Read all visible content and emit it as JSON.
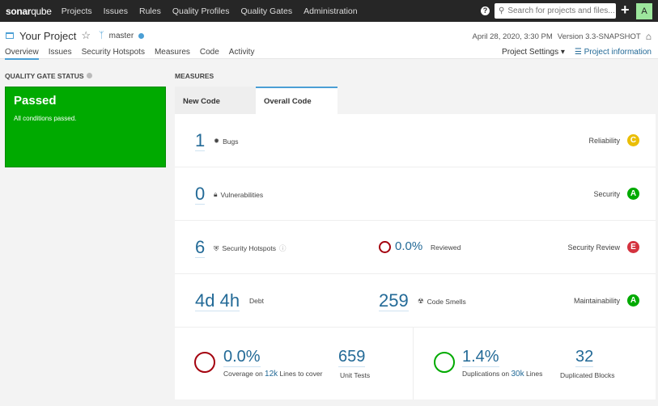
{
  "topbar": {
    "logo_bold": "sonar",
    "logo_rest": "qube",
    "nav": [
      "Projects",
      "Issues",
      "Rules",
      "Quality Profiles",
      "Quality Gates",
      "Administration"
    ],
    "search_placeholder": "Search for projects and files...",
    "avatar": "A",
    "help": "?",
    "plus": "+"
  },
  "project": {
    "name": "Your Project",
    "branch": "master",
    "date": "April 28, 2020, 3:30 PM",
    "version": "Version 3.3-SNAPSHOT",
    "tabs": [
      "Overview",
      "Issues",
      "Security Hotspots",
      "Measures",
      "Code",
      "Activity"
    ],
    "settings": "Project Settings ▾",
    "info": "Project information"
  },
  "quality_gate": {
    "label": "QUALITY GATE STATUS",
    "status": "Passed",
    "message": "All conditions passed.",
    "color": "#00aa00"
  },
  "measures": {
    "label": "MEASURES",
    "tabs": [
      "New Code",
      "Overall Code"
    ],
    "active_tab": "Overall Code",
    "bugs": {
      "value": "1",
      "label": "Bugs",
      "rating_label": "Reliability",
      "rating": "C",
      "color": "#eabe06"
    },
    "vulnerabilities": {
      "value": "0",
      "label": "Vulnerabilities",
      "rating_label": "Security",
      "rating": "A",
      "color": "#00aa00"
    },
    "hotspots": {
      "value": "6",
      "label": "Security Hotspots",
      "reviewed": "0.0%",
      "reviewed_label": "Reviewed",
      "rating_label": "Security Review",
      "rating": "E",
      "color": "#d4333f"
    },
    "maintainability": {
      "debt": "4d 4h",
      "debt_label": "Debt",
      "smells": "259",
      "smells_label": "Code Smells",
      "rating_label": "Maintainability",
      "rating": "A",
      "color": "#00aa00"
    },
    "coverage": {
      "value": "0.0%",
      "pre": "Coverage on",
      "lines": "12k",
      "post": "Lines to cover",
      "tests": "659",
      "tests_label": "Unit Tests",
      "ring_color": "#a4030f"
    },
    "duplications": {
      "value": "1.4%",
      "pre": "Duplications on",
      "lines": "30k",
      "post": "Lines",
      "blocks": "32",
      "blocks_label": "Duplicated Blocks",
      "ring_color": "#00aa00"
    }
  }
}
